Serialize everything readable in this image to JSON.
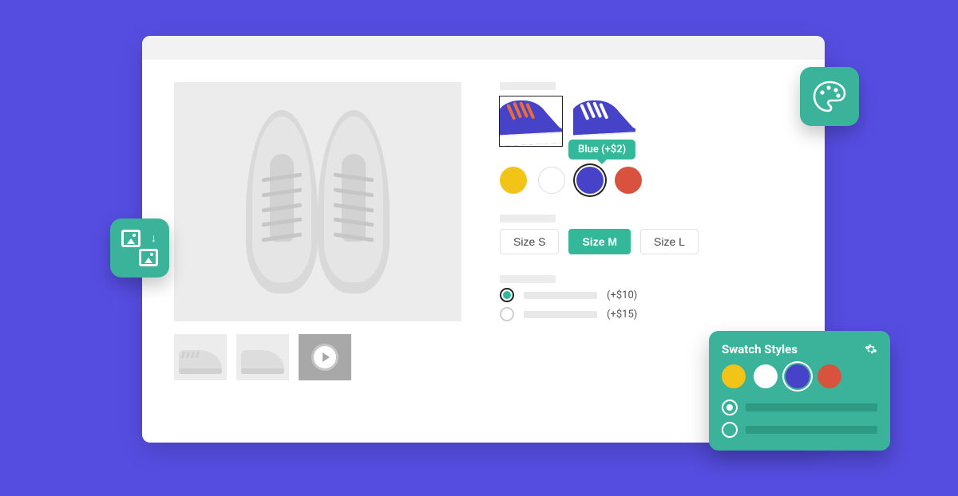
{
  "colors": {
    "background": "#554de0",
    "accent": "#34b89a",
    "panel": "#3ab39a"
  },
  "product": {
    "variant_thumbs": [
      {
        "name": "blue-orange-laces",
        "selected": true,
        "body": "#4643c9",
        "laces": "#e96c3a"
      },
      {
        "name": "blue-white-laces",
        "selected": false,
        "body": "#4643c9",
        "laces": "#ffffff"
      }
    ],
    "color_tooltip": "Blue (+$2)",
    "color_options": [
      {
        "name": "yellow",
        "hex": "#f2c418",
        "selected": false
      },
      {
        "name": "white",
        "hex": "#ffffff",
        "selected": false,
        "bordered": true
      },
      {
        "name": "blue",
        "hex": "#4643c9",
        "selected": true
      },
      {
        "name": "red",
        "hex": "#d9523e",
        "selected": false
      }
    ],
    "size_options": [
      {
        "label": "Size S",
        "selected": false
      },
      {
        "label": "Size M",
        "selected": true
      },
      {
        "label": "Size L",
        "selected": false
      }
    ],
    "addon_options": [
      {
        "price": "(+$10)",
        "selected": true
      },
      {
        "price": "(+$15)",
        "selected": false
      }
    ]
  },
  "swatch_panel": {
    "title": "Swatch Styles",
    "colors": [
      {
        "name": "yellow",
        "hex": "#f2c418",
        "selected": false
      },
      {
        "name": "white",
        "hex": "#ffffff",
        "selected": false
      },
      {
        "name": "blue",
        "hex": "#4643c9",
        "selected": true
      },
      {
        "name": "red",
        "hex": "#d9523e",
        "selected": false
      }
    ],
    "style_options": [
      {
        "selected": true
      },
      {
        "selected": false
      }
    ]
  }
}
